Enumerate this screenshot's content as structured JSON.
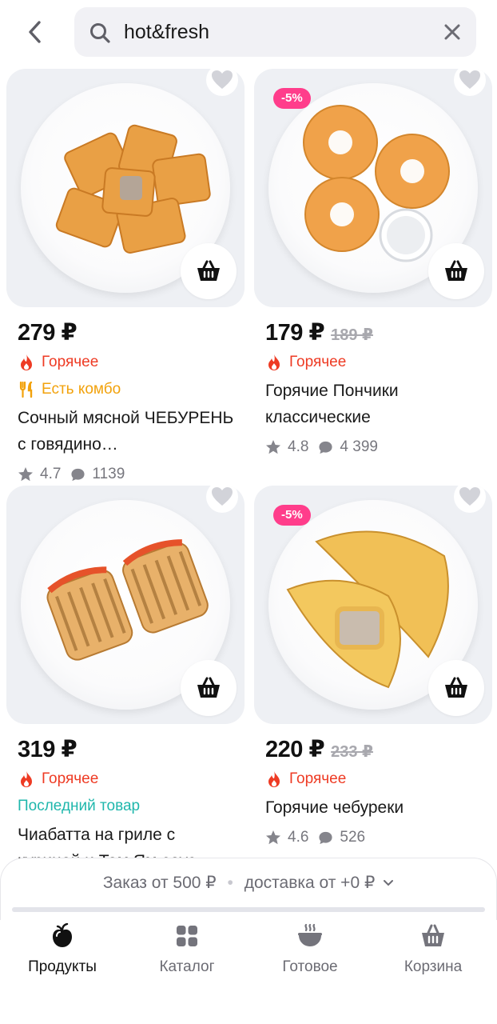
{
  "search": {
    "query": "hot&fresh"
  },
  "products": [
    {
      "price": "279 ₽",
      "old_price": "",
      "discount": "",
      "tags": [
        {
          "type": "hot",
          "label": "Горячее"
        },
        {
          "type": "combo",
          "label": "Есть комбо"
        }
      ],
      "title": "Сочный мясной ЧЕБУРЕНЬ с говядино…",
      "rating": "4.7",
      "reviews": "1139"
    },
    {
      "price": "179 ₽",
      "old_price": "189 ₽",
      "discount": "-5%",
      "tags": [
        {
          "type": "hot",
          "label": "Горячее"
        }
      ],
      "title": "Горячие Пончики классические",
      "rating": "4.8",
      "reviews": "4 399"
    },
    {
      "price": "319 ₽",
      "old_price": "",
      "discount": "",
      "tags": [
        {
          "type": "hot",
          "label": "Горячее"
        },
        {
          "type": "last",
          "label": "Последний товар"
        }
      ],
      "title": "Чиабатта на гриле с курицей и Том Ям соус",
      "rating": "",
      "reviews": ""
    },
    {
      "price": "220 ₽",
      "old_price": "233 ₽",
      "discount": "-5%",
      "tags": [
        {
          "type": "hot",
          "label": "Горячее"
        }
      ],
      "title": "Горячие чебуреки",
      "rating": "4.6",
      "reviews": "526"
    }
  ],
  "order_bar": {
    "min_order": "Заказ от 500 ₽",
    "separator": "•",
    "delivery": "доставка от +0 ₽"
  },
  "tabs": [
    {
      "label": "Продукты",
      "icon": "apple-icon",
      "active": true
    },
    {
      "label": "Каталог",
      "icon": "grid-icon",
      "active": false
    },
    {
      "label": "Готовое",
      "icon": "hot-dish-icon",
      "active": false
    },
    {
      "label": "Корзина",
      "icon": "basket-icon",
      "active": false
    }
  ],
  "colors": {
    "hot": "#ee3b24",
    "combo": "#f2a20c",
    "last": "#1fb7ac",
    "discount": "#ff3d8b"
  }
}
